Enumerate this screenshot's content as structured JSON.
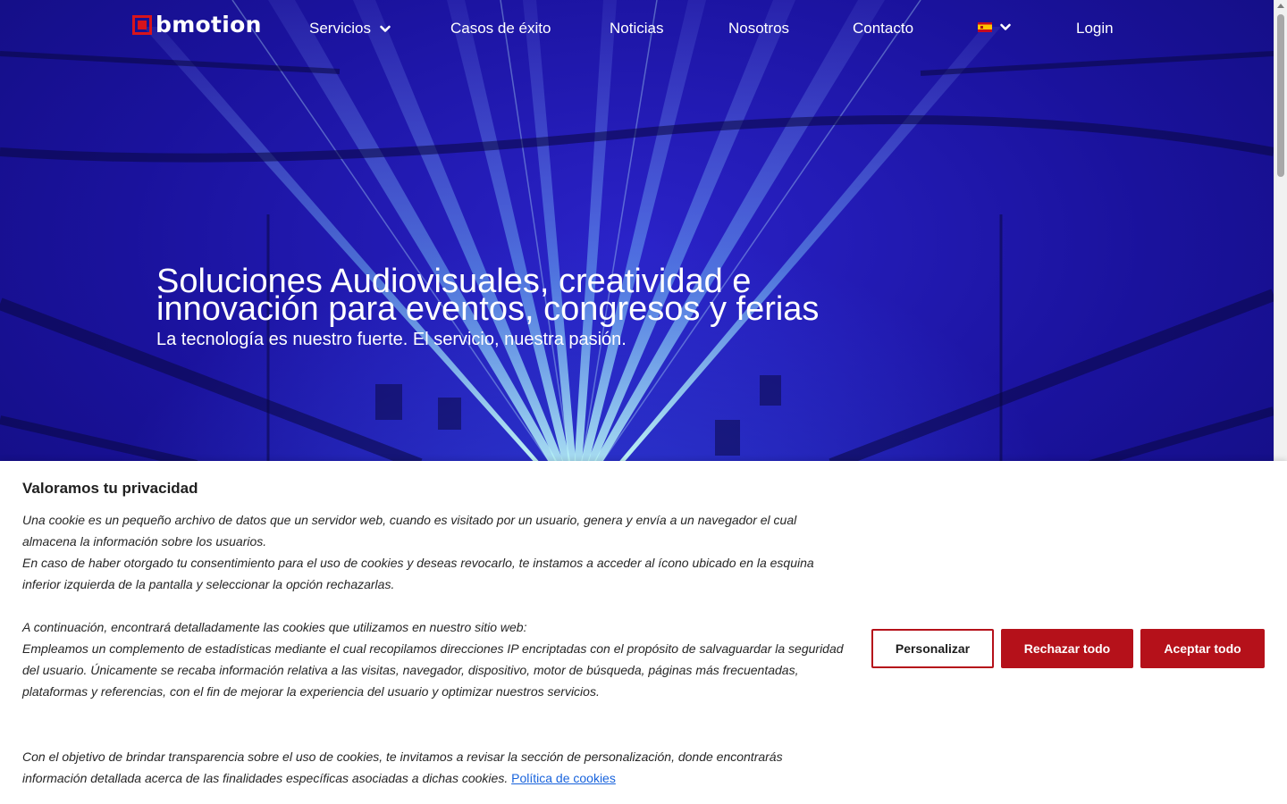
{
  "nav": {
    "logo": "bmotion",
    "items": [
      {
        "label": "Servicios",
        "has_dropdown": true
      },
      {
        "label": "Casos de éxito"
      },
      {
        "label": "Noticias"
      },
      {
        "label": "Nosotros"
      },
      {
        "label": "Contacto"
      }
    ],
    "language": {
      "flag_icon": "spain-flag-icon",
      "has_dropdown": true
    },
    "login": "Login"
  },
  "hero": {
    "title": "Soluciones Audiovisuales, creatividad e innovación para eventos, congresos y ferias",
    "subtitle": "La tecnología es nuestro fuerte. El servicio, nuestra pasión."
  },
  "cookie_banner": {
    "title": "Valoramos tu privacidad",
    "paragraph1": "Una cookie es un pequeño archivo de datos que un servidor web, cuando es visitado por un usuario, genera y envía a un navegador el cual almacena la información sobre los usuarios.",
    "paragraph2": "En caso de haber otorgado tu consentimiento para el uso de cookies y deseas revocarlo, te instamos a acceder al ícono ubicado en la esquina inferior izquierda de la pantalla y seleccionar la opción rechazarlas.",
    "paragraph3": "A continuación, encontrará detalladamente las cookies que utilizamos en nuestro sitio web:",
    "paragraph4": "Empleamos un complemento de estadísticas mediante el cual recopilamos direcciones IP encriptadas con el propósito de salvaguardar la seguridad del usuario. Únicamente se recaba información relativa a las visitas, navegador, dispositivo, motor de búsqueda, páginas más frecuentadas, plataformas y referencias, con el fin de mejorar la experiencia del usuario y optimizar nuestros servicios.",
    "paragraph5": "Con el objetivo de brindar transparencia sobre el uso de cookies, te invitamos a revisar la sección de personalización, donde encontrarás información detallada acerca de las finalidades específicas asociadas a dichas cookies.",
    "policy_link": "Política de cookies",
    "buttons": {
      "customize": "Personalizar",
      "reject": "Rechazar todo",
      "accept": "Aceptar todo"
    }
  },
  "colors": {
    "brand_red": "#b5111a",
    "hero_blue": "#1a129c",
    "link_blue": "#1863dc"
  }
}
